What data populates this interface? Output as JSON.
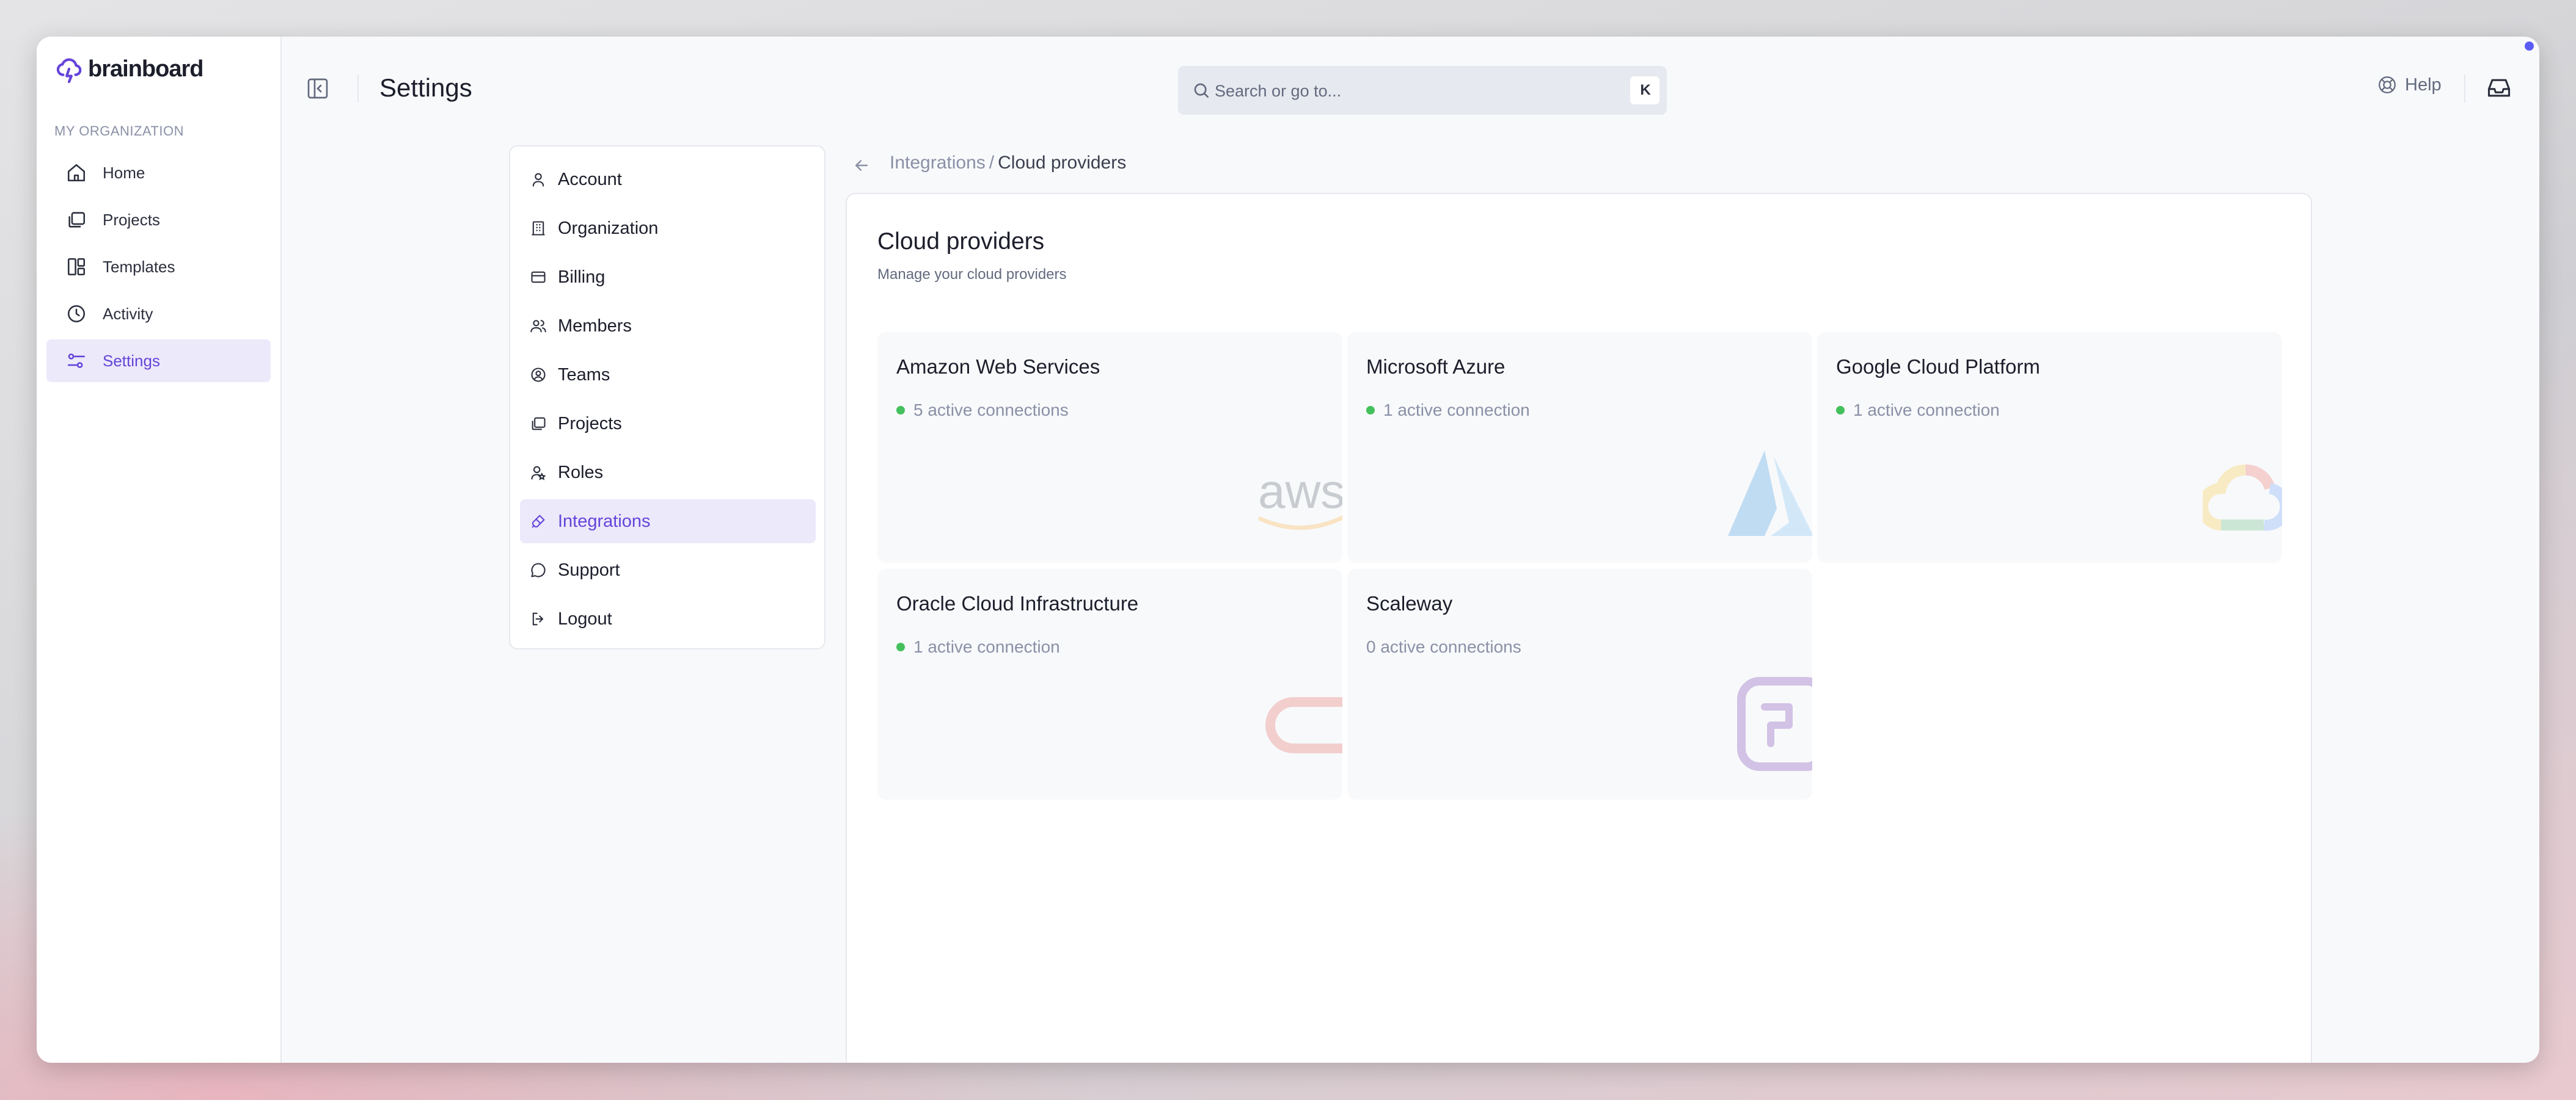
{
  "app": {
    "brand": "brainboard"
  },
  "sidebar": {
    "section_label": "MY ORGANIZATION",
    "items": [
      {
        "label": "Home",
        "icon": "home-icon",
        "active": false
      },
      {
        "label": "Projects",
        "icon": "projects-icon",
        "active": false
      },
      {
        "label": "Templates",
        "icon": "templates-icon",
        "active": false
      },
      {
        "label": "Activity",
        "icon": "clock-icon",
        "active": false
      },
      {
        "label": "Settings",
        "icon": "sliders-icon",
        "active": true
      }
    ]
  },
  "header": {
    "title": "Settings",
    "search_placeholder": "Search or go to...",
    "shortcut_keys": [
      "⌘",
      "K"
    ],
    "help_label": "Help"
  },
  "settings_menu": {
    "items": [
      {
        "label": "Account",
        "icon": "user-icon",
        "active": false
      },
      {
        "label": "Organization",
        "icon": "building-icon",
        "active": false
      },
      {
        "label": "Billing",
        "icon": "credit-card-icon",
        "active": false
      },
      {
        "label": "Members",
        "icon": "users-icon",
        "active": false
      },
      {
        "label": "Teams",
        "icon": "team-icon",
        "active": false
      },
      {
        "label": "Projects",
        "icon": "projects-icon",
        "active": false
      },
      {
        "label": "Roles",
        "icon": "role-icon",
        "active": false
      },
      {
        "label": "Integrations",
        "icon": "plug-icon",
        "active": true
      },
      {
        "label": "Support",
        "icon": "chat-icon",
        "active": false
      },
      {
        "label": "Logout",
        "icon": "logout-icon",
        "active": false
      }
    ]
  },
  "breadcrumb": {
    "parent": "Integrations",
    "separator": "/",
    "current": "Cloud providers"
  },
  "main": {
    "title": "Cloud providers",
    "subtitle": "Manage your cloud providers",
    "providers": [
      {
        "name": "Amazon Web Services",
        "status": "5 active connections",
        "has_connection": true,
        "logo": "aws-logo"
      },
      {
        "name": "Microsoft Azure",
        "status": "1 active connection",
        "has_connection": true,
        "logo": "azure-logo"
      },
      {
        "name": "Google Cloud Platform",
        "status": "1 active connection",
        "has_connection": true,
        "logo": "gcp-logo"
      },
      {
        "name": "Oracle Cloud Infrastructure",
        "status": "1 active connection",
        "has_connection": true,
        "logo": "oracle-logo"
      },
      {
        "name": "Scaleway",
        "status": "0 active connections",
        "has_connection": false,
        "logo": "scaleway-logo"
      }
    ]
  },
  "colors": {
    "accent": "#6545d9",
    "active_bg": "#ece9fb",
    "status_green": "#44c05c",
    "notification_dot": "#5b5bf5"
  }
}
